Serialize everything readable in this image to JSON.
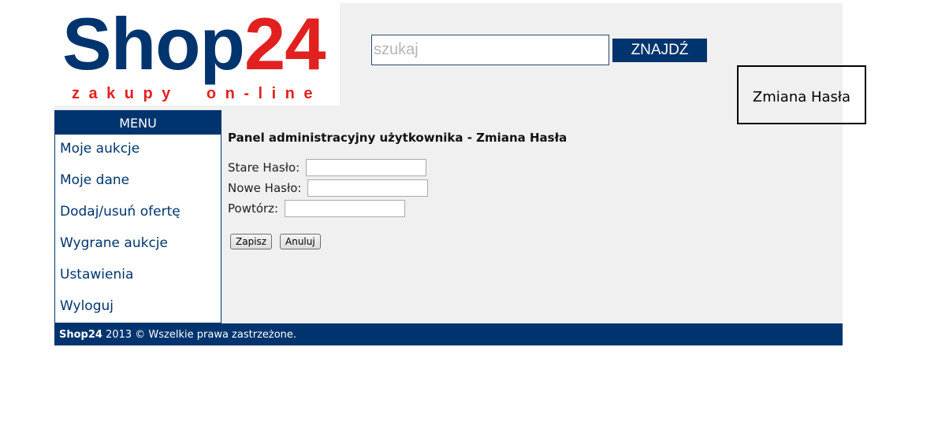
{
  "logo": {
    "brand": "Shop",
    "brand_number": "24",
    "tagline": "zakupy  on-line"
  },
  "search": {
    "placeholder": "szukaj",
    "value": "",
    "button_label": "ZNAJDŹ"
  },
  "page_title_box": "Zmiana Hasła",
  "sidebar": {
    "header": "MENU",
    "items": [
      {
        "label": "Moje aukcje"
      },
      {
        "label": "Moje dane"
      },
      {
        "label": "Dodaj/usuń ofertę"
      },
      {
        "label": "Wygrane aukcje"
      },
      {
        "label": "Ustawienia"
      },
      {
        "label": "Wyloguj"
      }
    ]
  },
  "panel": {
    "title": "Panel administracyjny użytkownika - Zmiana Hasła",
    "fields": [
      {
        "label": "Stare Hasło:",
        "value": ""
      },
      {
        "label": "Nowe Hasło:",
        "value": ""
      },
      {
        "label": "Powtórz:",
        "value": ""
      }
    ],
    "save_label": "Zapisz",
    "cancel_label": "Anuluj"
  },
  "footer": {
    "brand": "Shop24",
    "text": " 2013 © Wszelkie prawa zastrzeżone."
  },
  "colors": {
    "brand_navy": "#00346e",
    "brand_red": "#e1211f",
    "page_background": "#f0f0f0"
  }
}
